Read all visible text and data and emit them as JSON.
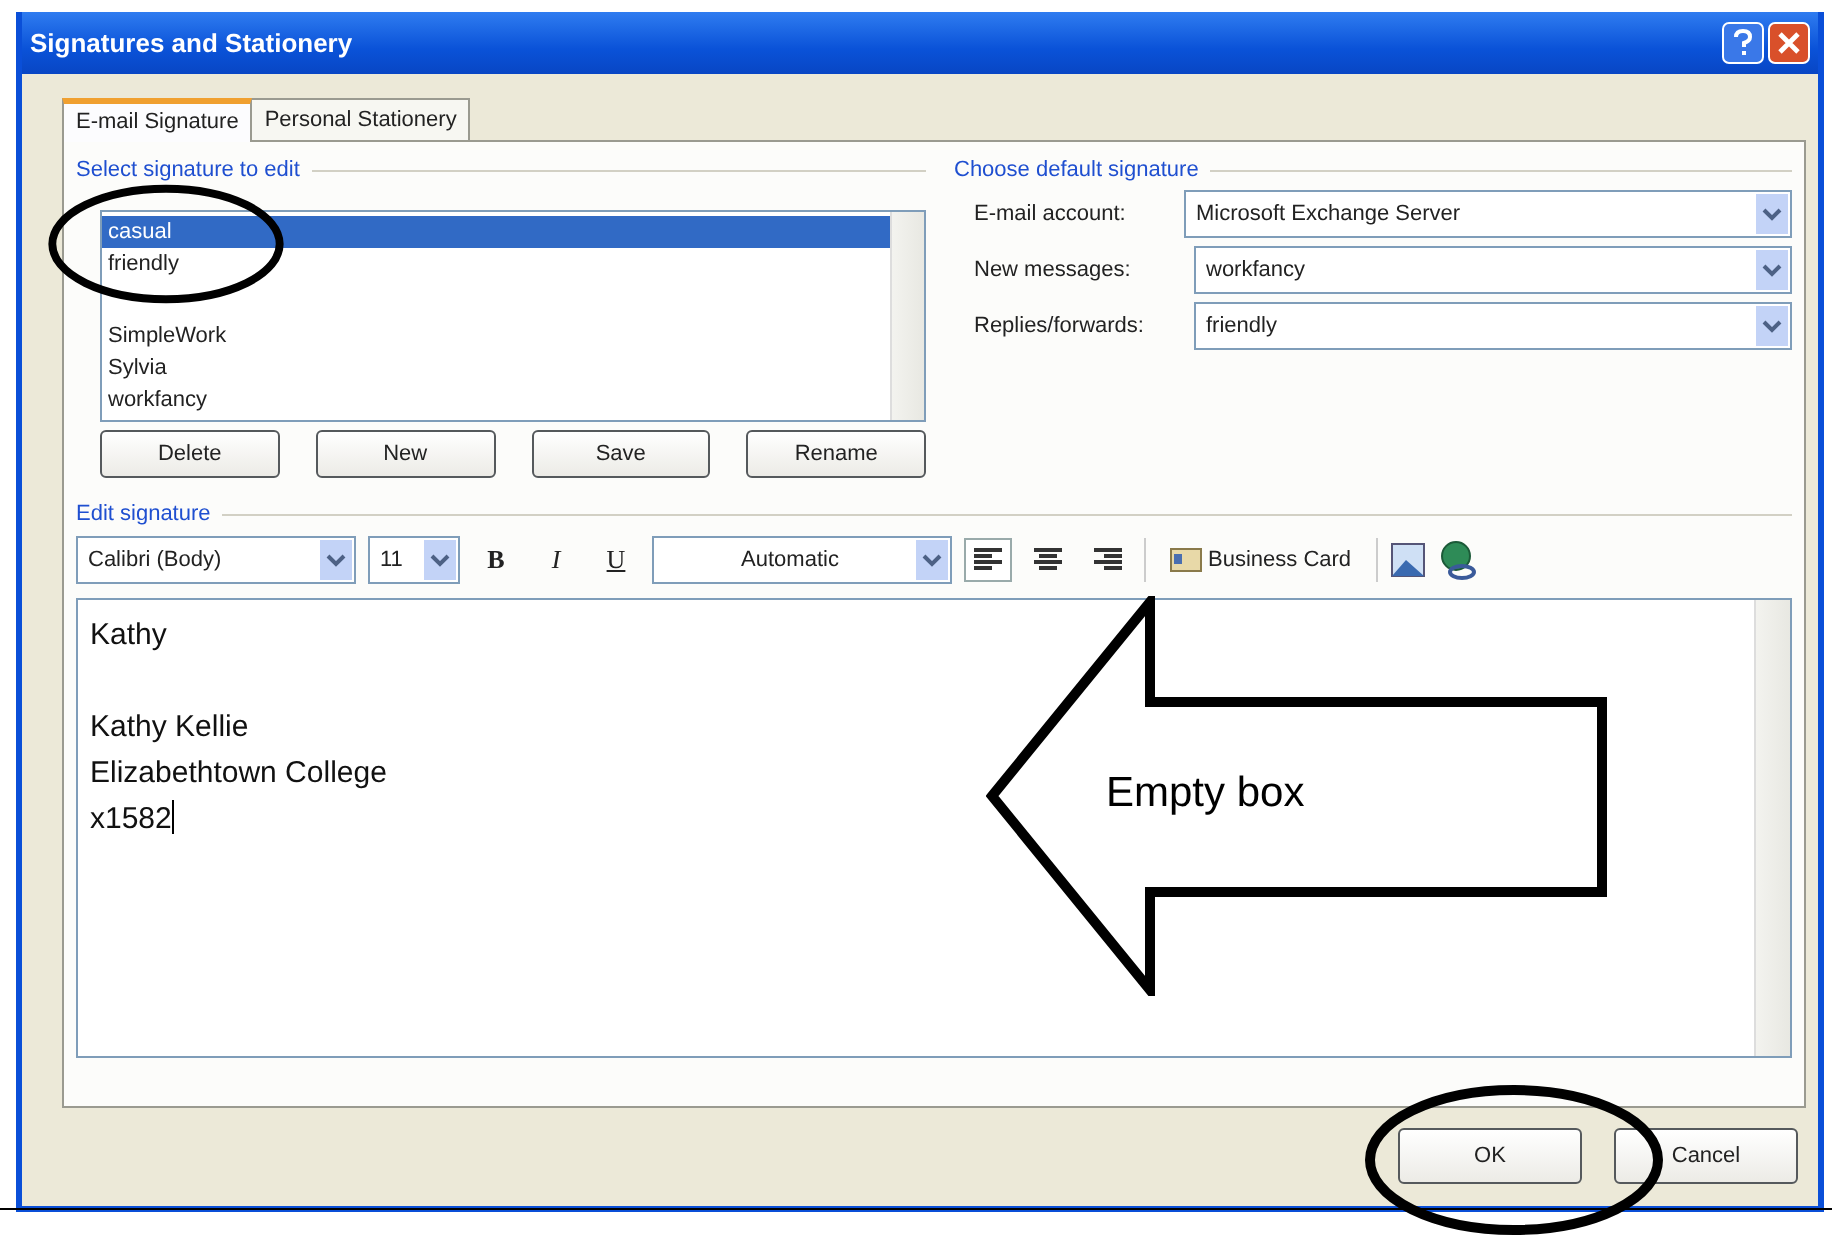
{
  "window": {
    "title": "Signatures and Stationery"
  },
  "tabs": [
    {
      "label": "E-mail Signature",
      "selected": true
    },
    {
      "label": "Personal Stationery",
      "selected": false
    }
  ],
  "select_signature": {
    "label": "Select signature to edit",
    "items": [
      {
        "name": "casual",
        "selected": true
      },
      {
        "name": "friendly",
        "selected": false
      },
      {
        "name": "SimpleWork",
        "selected": false
      },
      {
        "name": "Sylvia",
        "selected": false
      },
      {
        "name": "workfancy",
        "selected": false
      }
    ],
    "buttons": [
      "Delete",
      "New",
      "Save",
      "Rename"
    ]
  },
  "default_signature": {
    "label": "Choose default signature",
    "fields": [
      {
        "label": "E-mail account:",
        "value": "Microsoft Exchange Server"
      },
      {
        "label": "New messages:",
        "value": "workfancy"
      },
      {
        "label": "Replies/forwards:",
        "value": "friendly"
      }
    ]
  },
  "edit_signature": {
    "label": "Edit signature",
    "font": "Calibri (Body)",
    "size": "11",
    "bold": "B",
    "italic": "I",
    "underline": "U",
    "font_color_label": "Automatic",
    "align_buttons": [
      {
        "kind": "left",
        "selected": true
      },
      {
        "kind": "center",
        "selected": false
      },
      {
        "kind": "right",
        "selected": false
      }
    ],
    "business_card": "Business Card",
    "paragraphs": [
      {
        "lines": [
          "Kathy"
        ]
      },
      {
        "lines": [
          "Kathy Kellie",
          "Elizabethtown College",
          "x1582"
        ]
      }
    ]
  },
  "buttons": [
    "OK",
    "Cancel"
  ],
  "callout": {
    "text": "Empty box"
  }
}
